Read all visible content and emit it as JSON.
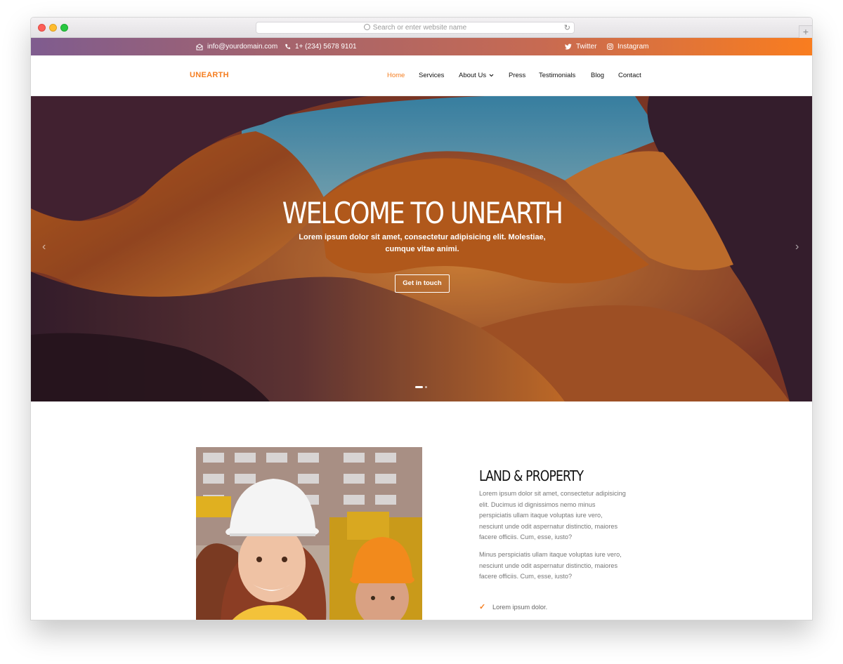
{
  "browser": {
    "address_placeholder": "Search or enter website name",
    "new_tab_symbol": "+"
  },
  "topbar": {
    "email": "info@yourdomain.com",
    "phone": "1+ (234) 5678 9101",
    "twitter": "Twitter",
    "instagram": "Instagram"
  },
  "nav": {
    "logo": "UNEARTH",
    "items": [
      {
        "label": "Home",
        "active": true
      },
      {
        "label": "Services"
      },
      {
        "label": "About Us",
        "dropdown": true
      },
      {
        "label": "Press"
      },
      {
        "label": "Testimonials"
      },
      {
        "label": "Blog"
      },
      {
        "label": "Contact"
      }
    ]
  },
  "hero": {
    "title": "WELCOME TO UNEARTH",
    "subtitle": "Lorem ipsum dolor sit amet, consectetur adipisicing elit. Molestiae, cumque vitae animi.",
    "button": "Get in touch",
    "prev_arrow": "‹",
    "next_arrow": "›",
    "slides": 2,
    "active_slide": 1
  },
  "about": {
    "title": "LAND & PROPERTY",
    "paragraph1": "Lorem ipsum dolor sit amet, consectetur adipisicing elit. Ducimus id dignissimos nemo minus perspiciatis ullam itaque voluptas iure vero, nesciunt unde odit aspernatur distinctio, maiores facere officiis. Cum, esse, iusto?",
    "paragraph2": "Minus perspiciatis ullam itaque voluptas iure vero, nesciunt unde odit aspernatur distinctio, maiores facere officiis. Cum, esse, iusto?",
    "checklist": [
      "Lorem ipsum dolor."
    ]
  },
  "colors": {
    "accent": "#f57e20",
    "topbar_start": "#7f5c8f",
    "topbar_end": "#f97d1f"
  }
}
